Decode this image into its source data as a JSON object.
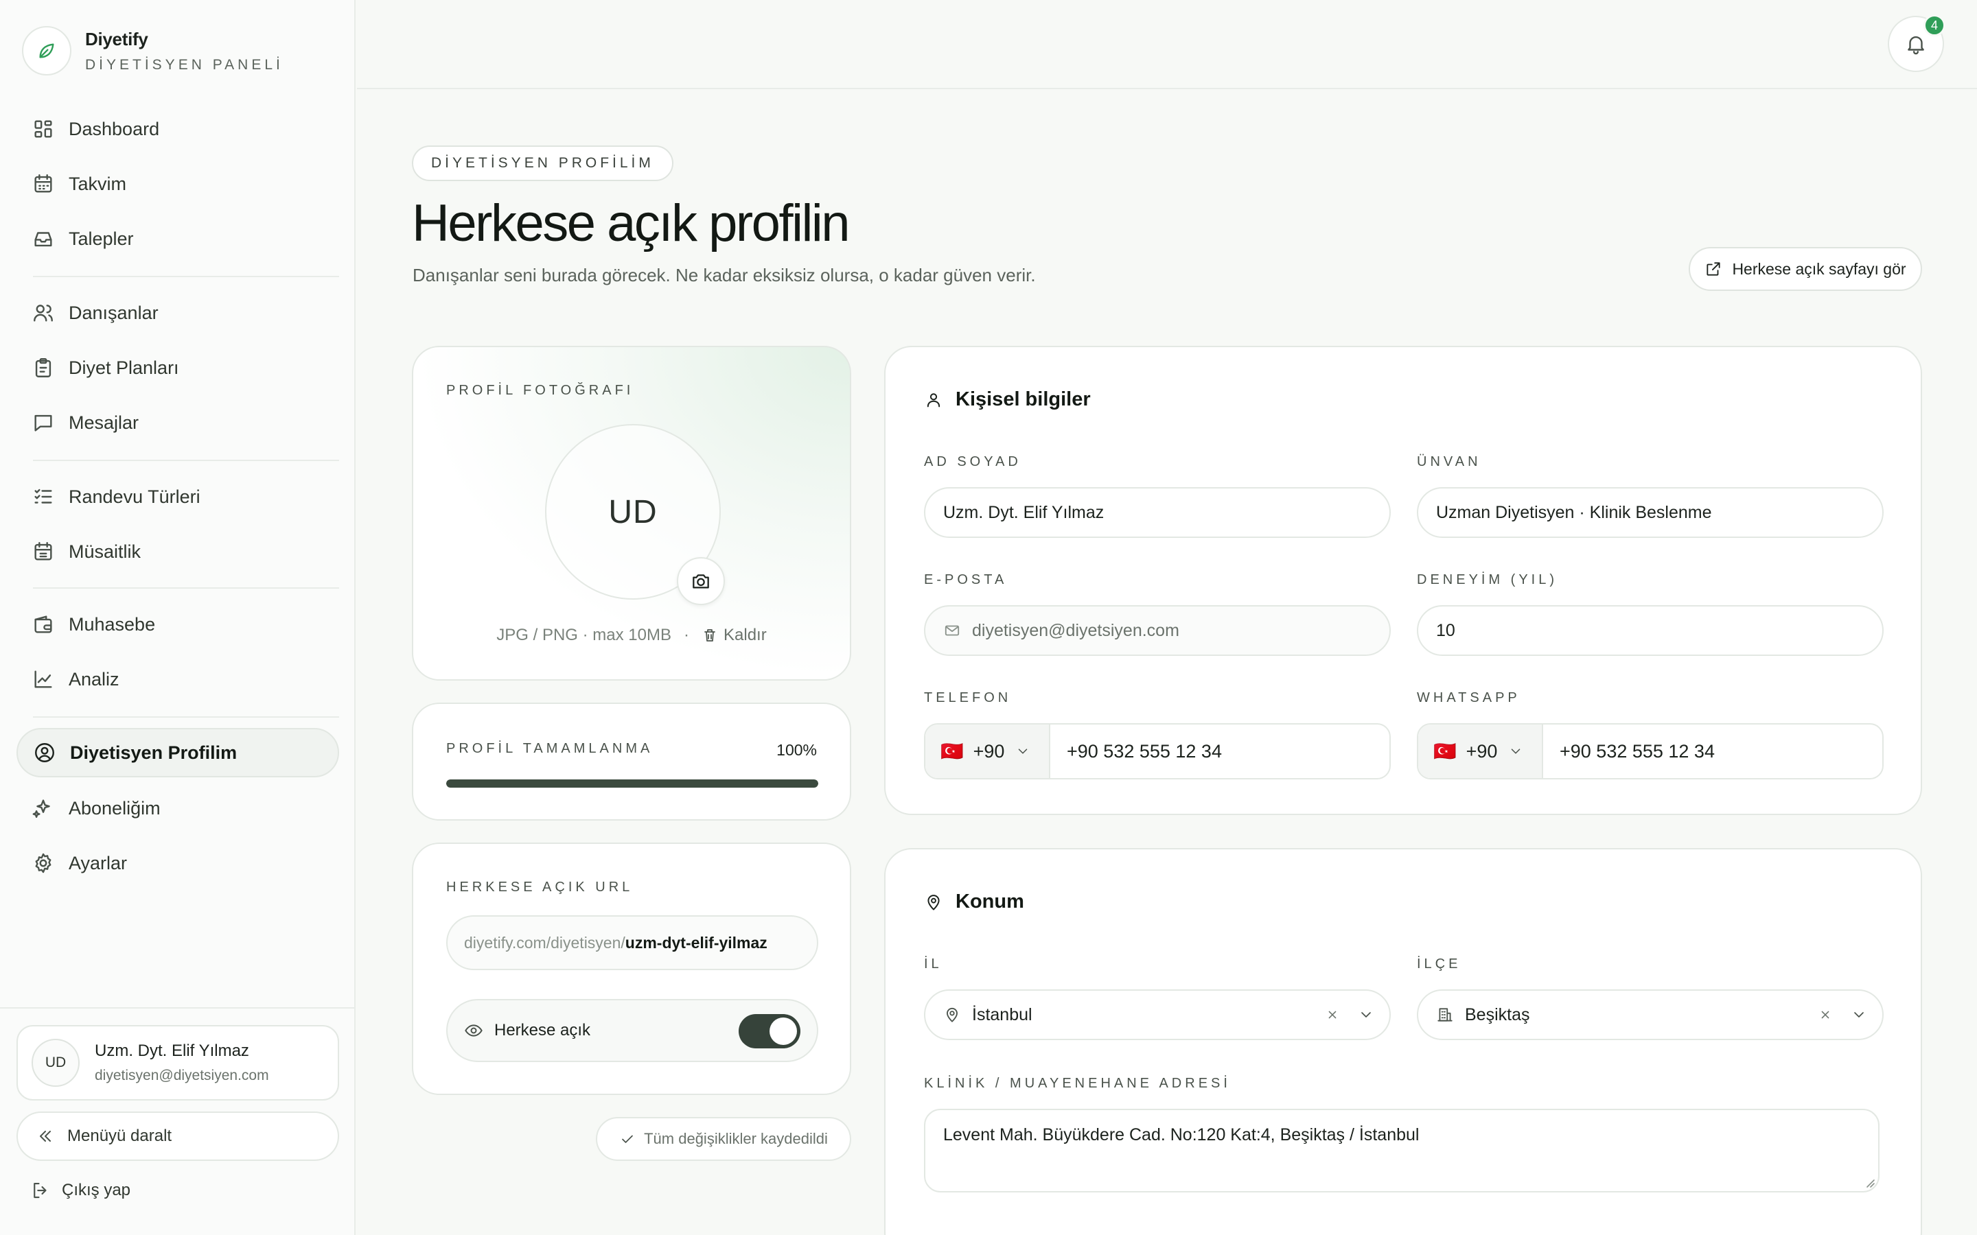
{
  "brand": {
    "name": "Diyetify",
    "subtitle": "DİYETİSYEN PANELİ"
  },
  "nav": {
    "items": [
      {
        "label": "Dashboard",
        "icon": "dashboard-icon"
      },
      {
        "label": "Takvim",
        "icon": "calendar-icon"
      },
      {
        "label": "Talepler",
        "icon": "inbox-icon"
      },
      {
        "label": "Danışanlar",
        "icon": "users-icon"
      },
      {
        "label": "Diyet Planları",
        "icon": "clipboard-icon"
      },
      {
        "label": "Mesajlar",
        "icon": "message-icon"
      },
      {
        "label": "Randevu Türleri",
        "icon": "list-check-icon"
      },
      {
        "label": "Müsaitlik",
        "icon": "calendar-grid-icon"
      },
      {
        "label": "Muhasebe",
        "icon": "wallet-icon"
      },
      {
        "label": "Analiz",
        "icon": "chart-line-icon"
      },
      {
        "label": "Diyetisyen Profilim",
        "icon": "user-circle-icon",
        "active": true
      },
      {
        "label": "Aboneliğim",
        "icon": "sparkles-icon"
      },
      {
        "label": "Ayarlar",
        "icon": "gear-icon"
      }
    ]
  },
  "user": {
    "initials": "UD",
    "name": "Uzm. Dyt. Elif Yılmaz",
    "email": "diyetisyen@diyetsiyen.com"
  },
  "sidebar_actions": {
    "collapse": "Menüyü daralt",
    "logout": "Çıkış yap"
  },
  "topbar": {
    "notification_count": "4"
  },
  "header": {
    "eyebrow": "DİYETİSYEN PROFİLİM",
    "title": "Herkese açık profilin",
    "subtitle": "Danışanlar seni burada görecek. Ne kadar eksiksiz olursa, o kadar güven verir.",
    "public_page_button": "Herkese açık sayfayı gör"
  },
  "photo": {
    "label": "PROFİL FOTOĞRAFI",
    "initials": "UD",
    "hint": "JPG / PNG · max 10MB",
    "separator": "·",
    "remove": "Kaldır"
  },
  "completion": {
    "label": "PROFİL TAMAMLANMA",
    "percent_text": "100%",
    "percent": 100
  },
  "public_url": {
    "label": "HERKESE AÇIK URL",
    "prefix": "diyetify.com/diyetisyen/",
    "slug": "uzm-dyt-elif-yilmaz",
    "visibility_label": "Herkese açık",
    "visibility_on": true
  },
  "save_status": "Tüm değişiklikler kaydedildi",
  "personal": {
    "title": "Kişisel bilgiler",
    "name_label": "AD SOYAD",
    "name_value": "Uzm. Dyt. Elif Yılmaz",
    "title_label": "ÜNVAN",
    "title_value": "Uzman Diyetisyen · Klinik Beslenme",
    "email_label": "E-POSTA",
    "email_value": "diyetisyen@diyetsiyen.com",
    "experience_label": "DENEYİM (YIL)",
    "experience_value": "10",
    "phone_label": "TELEFON",
    "phone_cc": "+90",
    "phone_value": "+90 532 555 12 34",
    "whatsapp_label": "WHATSAPP",
    "whatsapp_cc": "+90",
    "whatsapp_value": "+90 532 555 12 34",
    "flag": "🇹🇷"
  },
  "location": {
    "title": "Konum",
    "city_label": "İL",
    "city_value": "İstanbul",
    "district_label": "İLÇE",
    "district_value": "Beşiktaş",
    "address_label": "KLİNİK / MUAYENEHANE ADRESİ",
    "address_value": "Levent Mah. Büyükdere Cad. No:120 Kat:4, Beşiktaş / İstanbul"
  },
  "colors": {
    "accent": "#2f9e58",
    "toggle_on": "#36433a",
    "progress": "#3b4a3e"
  }
}
